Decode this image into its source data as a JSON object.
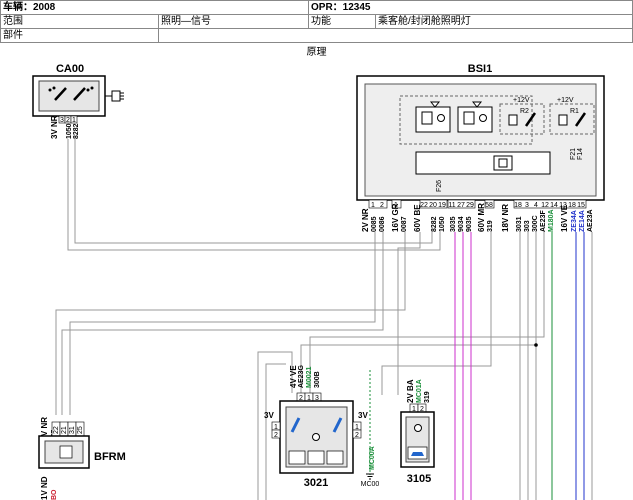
{
  "header": {
    "vehicle_label": "车辆：2008",
    "opr_label": "OPR：12345",
    "scope_label": "范围",
    "scope_value": "照明—信号",
    "function_label": "功能",
    "function_value": "乘客舱/封闭舱照明灯",
    "part_label": "部件",
    "part_value": ""
  },
  "title": "原理",
  "components": {
    "ca00": {
      "name": "CA00",
      "conn": "3V NR",
      "pins": [
        "3",
        "2",
        "1"
      ],
      "wires": [
        "1050",
        "8282"
      ]
    },
    "bsi1": {
      "name": "BSI1",
      "relays": [
        "R2",
        "R1"
      ],
      "supplies": [
        "+12V",
        "+12V"
      ],
      "fuses": [
        "F26",
        "F21",
        "F14"
      ],
      "connectors": [
        {
          "label": "2V NR",
          "pins": [
            "1",
            "2"
          ],
          "wires": [
            "0085",
            "0086"
          ]
        },
        {
          "label": "16V GR",
          "pins": [
            "1"
          ],
          "wires": [
            "0087"
          ]
        },
        {
          "label": "60V BE",
          "pins": [
            "22",
            "20",
            "19"
          ],
          "wires": [
            "8282",
            "1050"
          ]
        },
        {
          "label": "",
          "pins": [
            "11",
            "27",
            "29"
          ],
          "wires": [
            "3035",
            "9034",
            "9035"
          ]
        },
        {
          "label": "60V MR",
          "pins": [
            "58"
          ],
          "wires": [
            "319"
          ]
        },
        {
          "label": "18V NR",
          "pins": [
            "18",
            "3",
            "4",
            "12",
            "14",
            "13",
            "18",
            "15"
          ],
          "wires": [
            "3031",
            "303",
            "300C",
            "AE23F",
            "M180A"
          ]
        },
        {
          "label": "16V VE",
          "pins": [],
          "wires": [
            "ZE34A",
            "ZE14A",
            "AE23A"
          ]
        }
      ]
    },
    "bfrm": {
      "name": "BFRM",
      "conn": "54V NR",
      "pins": [
        "22",
        "21",
        "31",
        "25"
      ],
      "wires": [
        "0085",
        "0086",
        "0087"
      ],
      "conn2": "1V ND",
      "wire2": "BO"
    },
    "c3021": {
      "name": "3021",
      "conn": "4V VE",
      "pins": [
        "2",
        "1",
        "3"
      ],
      "wires": [
        "AE23G",
        "M0021",
        "300B"
      ],
      "side_conn": "3V",
      "side_pins": [
        "1",
        "2"
      ]
    },
    "c3105": {
      "name": "3105",
      "conn": "2V BA",
      "pins": [
        "1",
        "2"
      ],
      "wires": [
        "MC01A",
        "319"
      ]
    },
    "ground": {
      "wire": "MC00A",
      "label": "MC00"
    }
  }
}
